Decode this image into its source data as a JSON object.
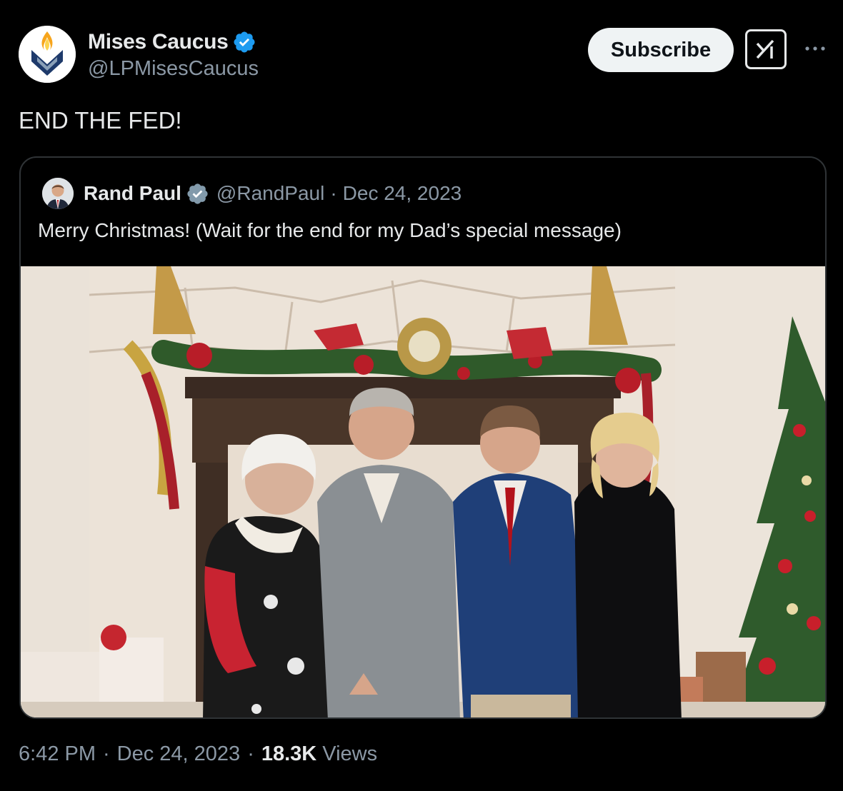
{
  "author": {
    "name": "Mises Caucus",
    "handle": "@LPMisesCaucus",
    "verified_icon": "verified-badge-icon"
  },
  "actions": {
    "subscribe_label": "Subscribe",
    "grok_icon": "grok-icon",
    "more_icon": "more-options-icon"
  },
  "tweet": {
    "text": "END THE FED!"
  },
  "quote": {
    "name": "Rand Paul",
    "handle": "@RandPaul",
    "separator": "·",
    "date": "Dec 24, 2023",
    "text": "Merry Christmas! (Wait for the end for my Dad’s special message)"
  },
  "footer": {
    "time": "6:42 PM",
    "sep1": "·",
    "date": "Dec 24, 2023",
    "sep2": "·",
    "views_count": "18.3K",
    "views_label": "Views"
  },
  "colors": {
    "background": "#000000",
    "text": "#e7e9ea",
    "muted": "#8b98a5",
    "verified_blue": "#1d9bf0",
    "verified_gray": "#829aab",
    "border": "#2f3336"
  }
}
